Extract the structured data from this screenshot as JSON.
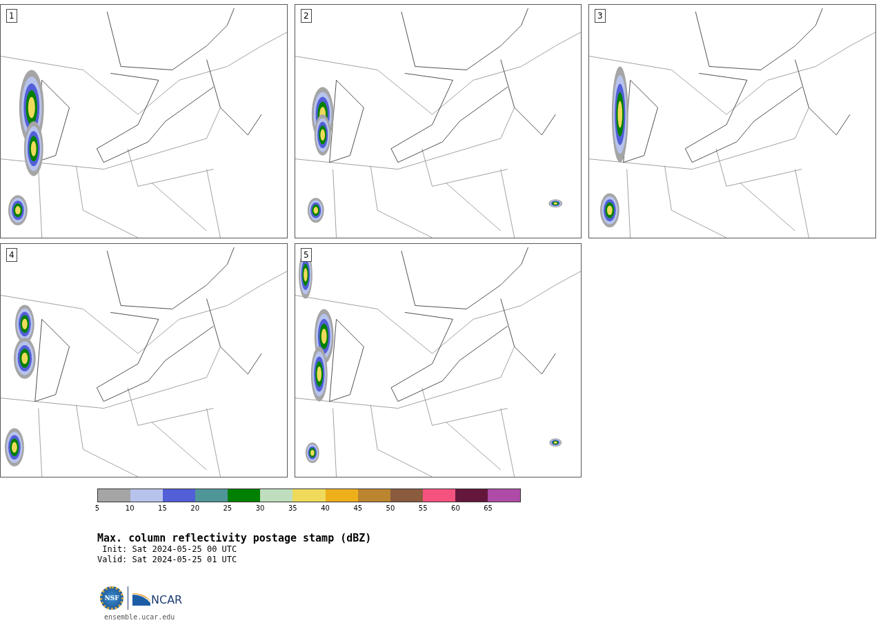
{
  "panels": [
    {
      "label": "1"
    },
    {
      "label": "2"
    },
    {
      "label": "3"
    },
    {
      "label": "4"
    },
    {
      "label": "5"
    }
  ],
  "colorbar": {
    "segments": [
      {
        "color": "#a5a5a5"
      },
      {
        "color": "#b7c3ed"
      },
      {
        "color": "#525fd6"
      },
      {
        "color": "#4f9698"
      },
      {
        "color": "#008000"
      },
      {
        "color": "#bfdebd"
      },
      {
        "color": "#efda5c"
      },
      {
        "color": "#efaf1a"
      },
      {
        "color": "#bb852f"
      },
      {
        "color": "#8a5b3d"
      },
      {
        "color": "#f5527f"
      },
      {
        "color": "#64173a"
      },
      {
        "color": "#ad4ba6"
      }
    ],
    "ticks": [
      "5",
      "10",
      "15",
      "20",
      "25",
      "30",
      "35",
      "40",
      "45",
      "50",
      "55",
      "60",
      "65"
    ]
  },
  "title": "Max. column reflectivity postage stamp (dBZ)",
  "init": " Init: Sat 2024-05-25 00 UTC",
  "valid": "Valid: Sat 2024-05-25 01 UTC",
  "logo": {
    "left": "NSF",
    "right": "NCAR"
  },
  "footer": "ensemble.ucar.edu"
}
